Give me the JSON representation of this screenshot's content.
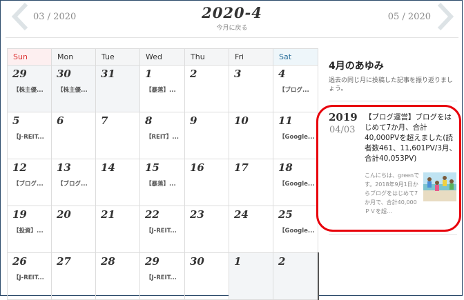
{
  "nav": {
    "prev_label": "03 / 2020",
    "next_label": "05 / 2020",
    "title": "2020-4",
    "back_label": "今月に戻る"
  },
  "weekdays": [
    "Sun",
    "Mon",
    "Tue",
    "Wed",
    "Thu",
    "Fri",
    "Sat"
  ],
  "weeks": [
    [
      {
        "day": "29",
        "other": true,
        "post": "【株主優..."
      },
      {
        "day": "30",
        "other": true,
        "post": "【株主優..."
      },
      {
        "day": "31",
        "other": true,
        "post": ""
      },
      {
        "day": "1",
        "post": "【暴落】..."
      },
      {
        "day": "2",
        "post": ""
      },
      {
        "day": "3",
        "post": ""
      },
      {
        "day": "4",
        "post": "【ブログ..."
      }
    ],
    [
      {
        "day": "5",
        "post": "【J-REIT..."
      },
      {
        "day": "6",
        "post": ""
      },
      {
        "day": "7",
        "post": ""
      },
      {
        "day": "8",
        "post": "【REIT】..."
      },
      {
        "day": "9",
        "post": ""
      },
      {
        "day": "10",
        "post": ""
      },
      {
        "day": "11",
        "post": "【Google..."
      }
    ],
    [
      {
        "day": "12",
        "post": "【ブログ..."
      },
      {
        "day": "13",
        "post": "【ブログ..."
      },
      {
        "day": "14",
        "post": ""
      },
      {
        "day": "15",
        "post": "【暴落】..."
      },
      {
        "day": "16",
        "post": ""
      },
      {
        "day": "17",
        "post": ""
      },
      {
        "day": "18",
        "post": "【Google..."
      }
    ],
    [
      {
        "day": "19",
        "post": "【投資】..."
      },
      {
        "day": "20",
        "post": ""
      },
      {
        "day": "21",
        "post": ""
      },
      {
        "day": "22",
        "post": "【J-REIT..."
      },
      {
        "day": "23",
        "post": ""
      },
      {
        "day": "24",
        "post": ""
      },
      {
        "day": "25",
        "post": "【Google..."
      }
    ],
    [
      {
        "day": "26",
        "post": "【J-REIT..."
      },
      {
        "day": "27",
        "post": ""
      },
      {
        "day": "28",
        "post": ""
      },
      {
        "day": "29",
        "post": "【J-REIT..."
      },
      {
        "day": "30",
        "post": ""
      },
      {
        "day": "1",
        "other": true,
        "post": ""
      },
      {
        "day": "2",
        "other": true,
        "post": ""
      }
    ]
  ],
  "sidebar": {
    "title": "4月のあゆみ",
    "description": "過去の同じ月に投稿した記事を振り返りましょう。",
    "card": {
      "year": "2019",
      "date": "04/03",
      "title": "【ブログ運営】ブログをはじめて7か月、合計40,000PVを超えました(読者数461、11,601PV/3月、合計40,053PV)",
      "excerpt": "こんにちは、greenです。2018年9月1日からブログをはじめて7か月で、合計40,000ＰＶを超..."
    }
  },
  "colors": {
    "frame": "#2b4a6a",
    "sunday": "#d33333",
    "saturday": "#2a6f9a",
    "highlight": "#e8000b"
  }
}
